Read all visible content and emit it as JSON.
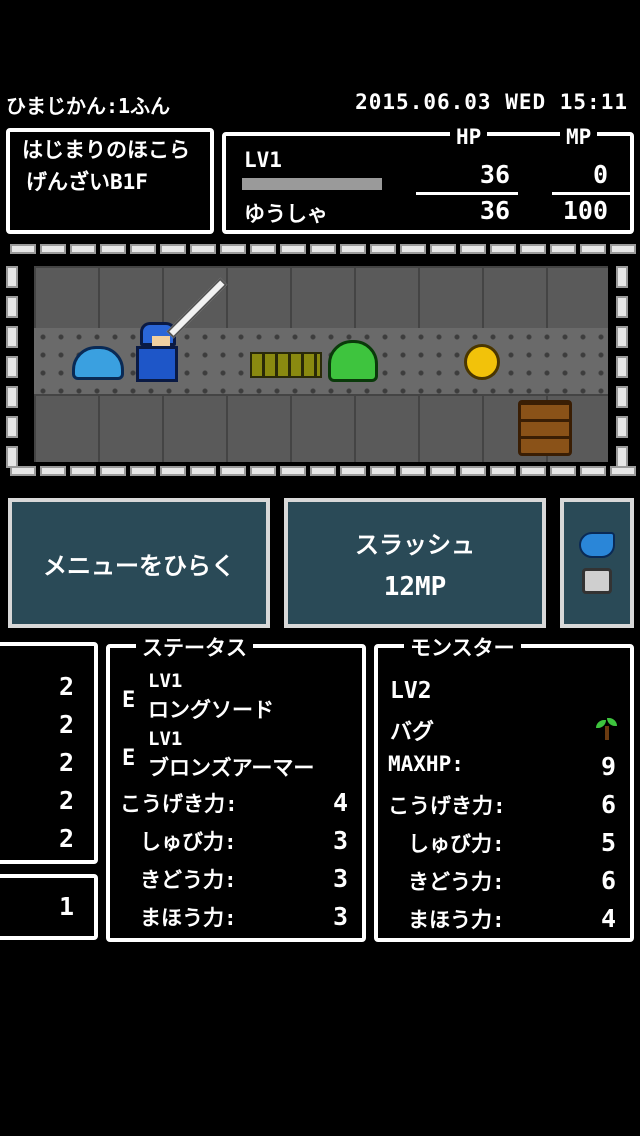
{
  "header": {
    "time_label": "ひまじかん:1ふん",
    "datetime": "2015.06.03 WED 15:11"
  },
  "location": {
    "line1": "はじまりのほこら",
    "line2": "げんざいB1F"
  },
  "player": {
    "level": "LV1",
    "name": "ゆうしゃ",
    "hp_label": "HP",
    "mp_label": "MP",
    "hp_current": "36",
    "hp_max": "36",
    "mp_current": "0",
    "mp_max": "100",
    "exp_fraction": 0
  },
  "dungeon": {
    "sprites": [
      "blue-slime",
      "hero-knight",
      "sword",
      "bug-monster",
      "green-slime",
      "gold-coin",
      "wooden-chest"
    ]
  },
  "actions": {
    "menu_label": "メニューをひらく",
    "skill_name": "スラッシュ",
    "skill_cost": "12MP",
    "side_icons": [
      "bird-icon",
      "bag-icon"
    ]
  },
  "left_panel": {
    "values": [
      "2",
      "2",
      "2",
      "2",
      "2"
    ],
    "bottom_value": "1"
  },
  "status": {
    "title": "ステータス",
    "equipment": [
      {
        "mark": "E",
        "level": "LV1",
        "name": "ロングソード"
      },
      {
        "mark": "E",
        "level": "LV1",
        "name": "ブロンズアーマー"
      }
    ],
    "stats": [
      {
        "label": "こうげき力:",
        "value": "4"
      },
      {
        "label": "しゅび力:",
        "value": "3"
      },
      {
        "label": "きどう力:",
        "value": "3"
      },
      {
        "label": "まほう力:",
        "value": "3"
      }
    ]
  },
  "monster": {
    "title": "モンスター",
    "level": "LV2",
    "name": "バグ",
    "icon": "sprout-icon",
    "stats": [
      {
        "label": "MAXHP:",
        "value": "9"
      },
      {
        "label": "こうげき力:",
        "value": "6"
      },
      {
        "label": "しゅび力:",
        "value": "5"
      },
      {
        "label": "きどう力:",
        "value": "6"
      },
      {
        "label": "まほう力:",
        "value": "4"
      }
    ]
  },
  "colors": {
    "panel": "#2a4a57",
    "frame": "#ffffff",
    "floor": "#5e5e5e",
    "brick": "#e6e6e6"
  }
}
